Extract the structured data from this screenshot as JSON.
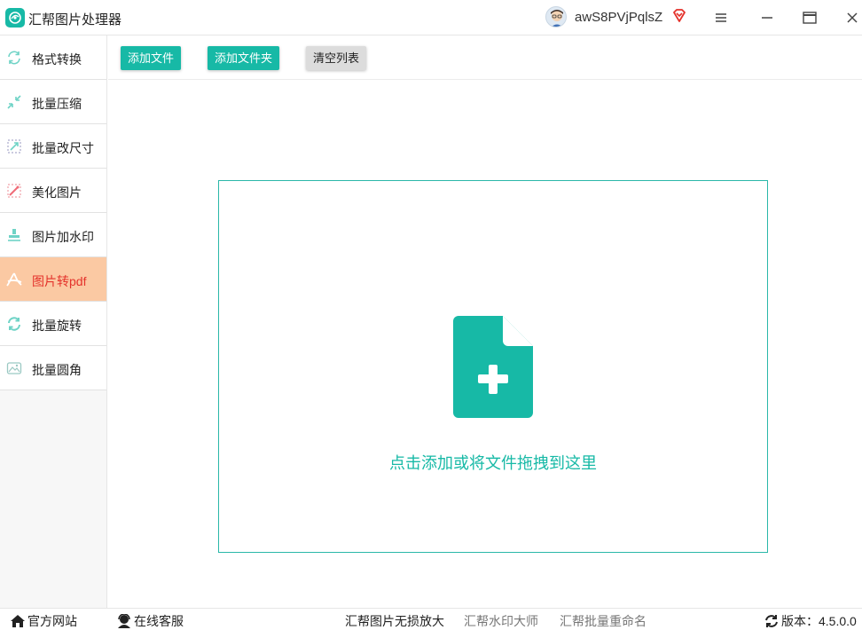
{
  "app": {
    "title": "汇帮图片处理器",
    "username": "awS8PVjPqlsZ"
  },
  "colors": {
    "accent": "#17b9a6",
    "active_bg": "#fbc9a3",
    "active_text": "#e4322b"
  },
  "sidebar": {
    "items": [
      {
        "label": "格式转换",
        "icon": "format-convert-icon"
      },
      {
        "label": "批量压缩",
        "icon": "compress-icon"
      },
      {
        "label": "批量改尺寸",
        "icon": "resize-icon"
      },
      {
        "label": "美化图片",
        "icon": "beautify-icon"
      },
      {
        "label": "图片加水印",
        "icon": "watermark-icon"
      },
      {
        "label": "图片转pdf",
        "icon": "pdf-icon",
        "active": true
      },
      {
        "label": "批量旋转",
        "icon": "rotate-icon"
      },
      {
        "label": "批量圆角",
        "icon": "rounded-corner-icon"
      }
    ]
  },
  "toolbar": {
    "add_file": "添加文件",
    "add_folder": "添加文件夹",
    "clear_list": "清空列表"
  },
  "dropzone": {
    "text": "点击添加或将文件拖拽到这里",
    "icon": "add-file-icon"
  },
  "footer": {
    "official_site": "官方网站",
    "online_service": "在线客服",
    "link_upscale": "汇帮图片无损放大",
    "link_watermark": "汇帮水印大师",
    "link_rename": "汇帮批量重命名",
    "version_label": "版本：4.5.0.0"
  }
}
